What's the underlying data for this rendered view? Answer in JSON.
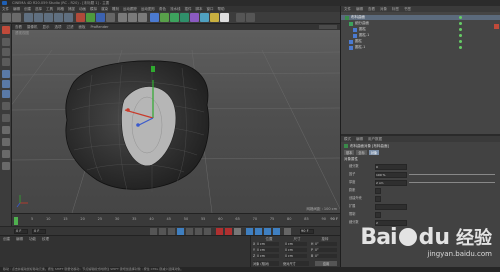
{
  "window": {
    "title": "CINEMA 4D R20.059 Studio (RC - R20) - [未标题 1] - 主要"
  },
  "menu": {
    "items": [
      "文件",
      "编辑",
      "创建",
      "选择",
      "工具",
      "网格",
      "捕捉",
      "动画",
      "模拟",
      "渲染",
      "雕刻",
      "运动跟踪",
      "运动图形",
      "角色",
      "流水线",
      "插件",
      "脚本",
      "窗口",
      "帮助"
    ]
  },
  "viewport": {
    "menu": [
      "查看",
      "摄像机",
      "显示",
      "选项",
      "过滤",
      "面板",
      "ProRender"
    ],
    "label": "透视视图",
    "grid_label": "网格间距 : 100 cm"
  },
  "timeline": {
    "ticks": [
      "0",
      "5",
      "10",
      "15",
      "20",
      "25",
      "30",
      "35",
      "40",
      "45",
      "50",
      "55",
      "60",
      "65",
      "70",
      "75",
      "80",
      "85",
      "90"
    ],
    "end": "90 F"
  },
  "playback": {
    "start": "0 F",
    "current": "0 F",
    "end": "90 F"
  },
  "materials": {
    "menu": [
      "创建",
      "编辑",
      "功能",
      "纹理"
    ]
  },
  "coords": {
    "headers": [
      "位置",
      "尺寸",
      "旋转"
    ],
    "rows": [
      {
        "axis": "X",
        "pos": "0 cm",
        "size": "0 cm",
        "rot_axis": "H",
        "rot": "0°"
      },
      {
        "axis": "Y",
        "pos": "0 cm",
        "size": "0 cm",
        "rot_axis": "P",
        "rot": "0°"
      },
      {
        "axis": "Z",
        "pos": "0 cm",
        "size": "0 cm",
        "rot_axis": "B",
        "rot": "0°"
      }
    ],
    "mode": "对象 (相对)",
    "size_mode": "绝对尺寸",
    "apply": "应用"
  },
  "object_manager": {
    "menu": [
      "文件",
      "编辑",
      "查看",
      "对象",
      "标签",
      "书签"
    ],
    "objects": [
      "布料曲面",
      "细分曲面",
      "圆柱",
      "圆柱.1",
      "圆柱",
      "圆柱.1"
    ]
  },
  "attributes": {
    "menu": [
      "模式",
      "编辑",
      "用户数据"
    ],
    "object_name": "布料曲面对象 [布料曲面]",
    "tabs": [
      "基本",
      "坐标",
      "对象"
    ],
    "section": "对象属性",
    "fields": [
      {
        "label": "细分数",
        "value": "0"
      },
      {
        "label": "因子",
        "value": "100 %"
      },
      {
        "label": "厚度",
        "value": "2 cm"
      },
      {
        "label": "膨胀",
        "value": ""
      },
      {
        "label": "创建外壳",
        "value": ""
      },
      {
        "label": "扩展",
        "value": ""
      },
      {
        "label": "限制",
        "value": ""
      },
      {
        "label": "细分数",
        "value": "2"
      }
    ]
  },
  "status": {
    "text": "移动 : 点击并拖动鼠标移动元素。按住 SHIFT 键量化移动 ; 节点编辑模式时按住 SHIFT 键增加选择对象 ; 按住 CTRL 键减少选择对象。"
  },
  "watermark": {
    "brand": "Bai",
    "brand2": "du",
    "cn": "经验",
    "url": "jingyan.baidu.com"
  }
}
